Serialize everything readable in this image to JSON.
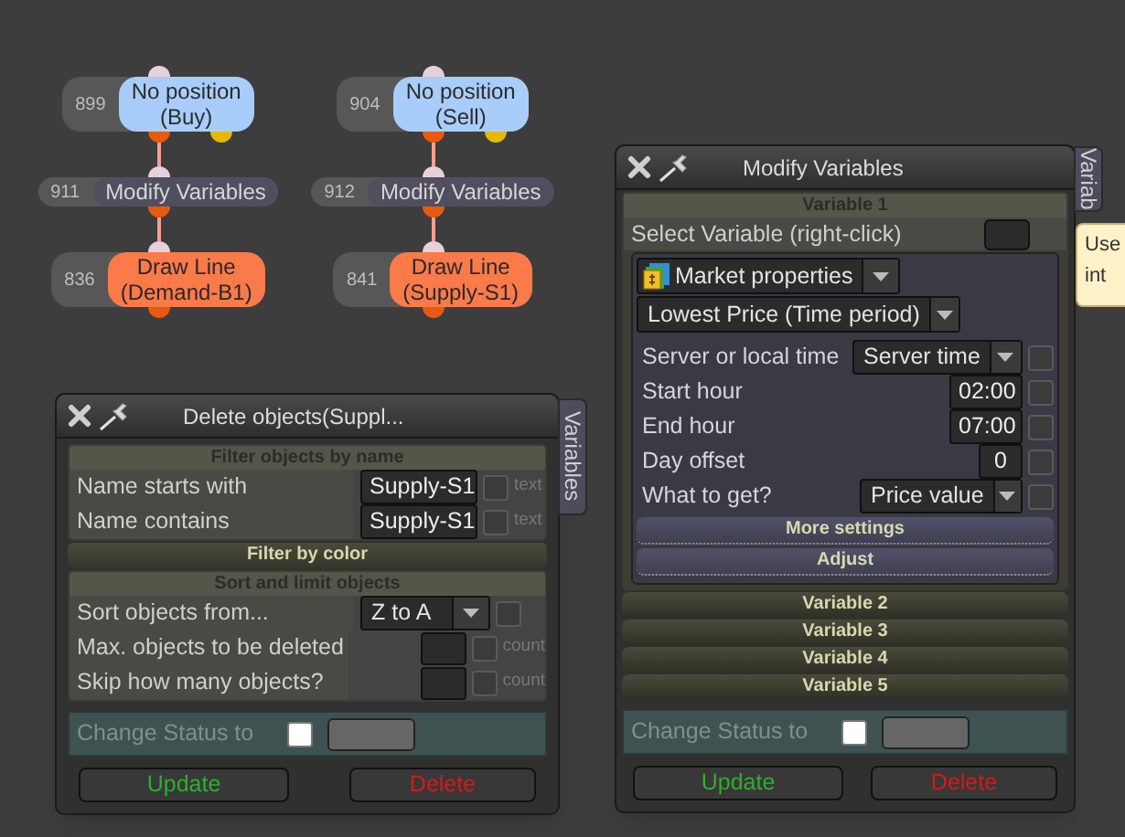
{
  "flows": [
    {
      "nodes": [
        {
          "id": "899",
          "lines": [
            "No position",
            "(Buy)"
          ],
          "kind": "condition"
        },
        {
          "id": "911",
          "lines": [
            "Modify Variables"
          ],
          "kind": "modify"
        },
        {
          "id": "836",
          "lines": [
            "Draw Line",
            "(Demand-B1)"
          ],
          "kind": "action"
        }
      ]
    },
    {
      "nodes": [
        {
          "id": "904",
          "lines": [
            "No position",
            "(Sell)"
          ],
          "kind": "condition"
        },
        {
          "id": "912",
          "lines": [
            "Modify Variables"
          ],
          "kind": "modify"
        },
        {
          "id": "841",
          "lines": [
            "Draw Line",
            "(Supply-S1)"
          ],
          "kind": "action"
        }
      ]
    }
  ],
  "delete_panel": {
    "title": "Delete objects(Suppl...",
    "tab_label": "Variables",
    "sections": [
      {
        "kind": "group",
        "title": "Filter objects by name",
        "rows": [
          {
            "kind": "text",
            "label": "Name starts with",
            "value": "Supply-S1",
            "checked": false,
            "suffix": "text"
          },
          {
            "kind": "text",
            "label": "Name contains",
            "value": "Supply-S1",
            "checked": false,
            "suffix": "text"
          }
        ]
      },
      {
        "kind": "header",
        "title": "Filter by color"
      },
      {
        "kind": "group",
        "title": "Sort and limit objects",
        "rows": [
          {
            "kind": "dropdown",
            "label": "Sort objects from...",
            "value": "Z to A",
            "checked": false
          },
          {
            "kind": "count",
            "label": "Max. objects to be deleted",
            "checked": false,
            "suffix": "count"
          },
          {
            "kind": "count",
            "label": "Skip how many objects?",
            "checked": false,
            "suffix": "count"
          }
        ]
      }
    ],
    "status": {
      "label": "Change Status to",
      "checked": false
    },
    "buttons": [
      {
        "label": "Update",
        "kind": "update"
      },
      {
        "label": "Delete",
        "kind": "delete"
      }
    ]
  },
  "modify_panel": {
    "title": "Modify Variables",
    "tab_label": "Variab",
    "variables": [
      {
        "title": "Variable 1",
        "expanded": true,
        "select_label": "Select Variable (right-click)",
        "source": "Market properties",
        "property": "Lowest Price (Time period)",
        "rows": [
          {
            "kind": "dropdown",
            "label": "Server or local time",
            "value": "Server time",
            "checked": false
          },
          {
            "kind": "text",
            "label": "Start hour",
            "value": "02:00",
            "checked": false
          },
          {
            "kind": "text",
            "label": "End hour",
            "value": "07:00",
            "checked": false
          },
          {
            "kind": "text",
            "label": "Day offset",
            "value": "0",
            "checked": false
          },
          {
            "kind": "dropdown",
            "label": "What to get?",
            "value": "Price value",
            "checked": false
          }
        ],
        "buttons": [
          "More settings",
          "Adjust"
        ]
      },
      {
        "title": "Variable 2",
        "expanded": false
      },
      {
        "title": "Variable 3",
        "expanded": false
      },
      {
        "title": "Variable 4",
        "expanded": false
      },
      {
        "title": "Variable 5",
        "expanded": false
      }
    ],
    "status": {
      "label": "Change Status to",
      "checked": false
    },
    "buttons": [
      {
        "label": "Update",
        "kind": "update"
      },
      {
        "label": "Delete",
        "kind": "delete"
      }
    ]
  },
  "tooltip": {
    "lines": [
      "Use",
      "int"
    ]
  }
}
